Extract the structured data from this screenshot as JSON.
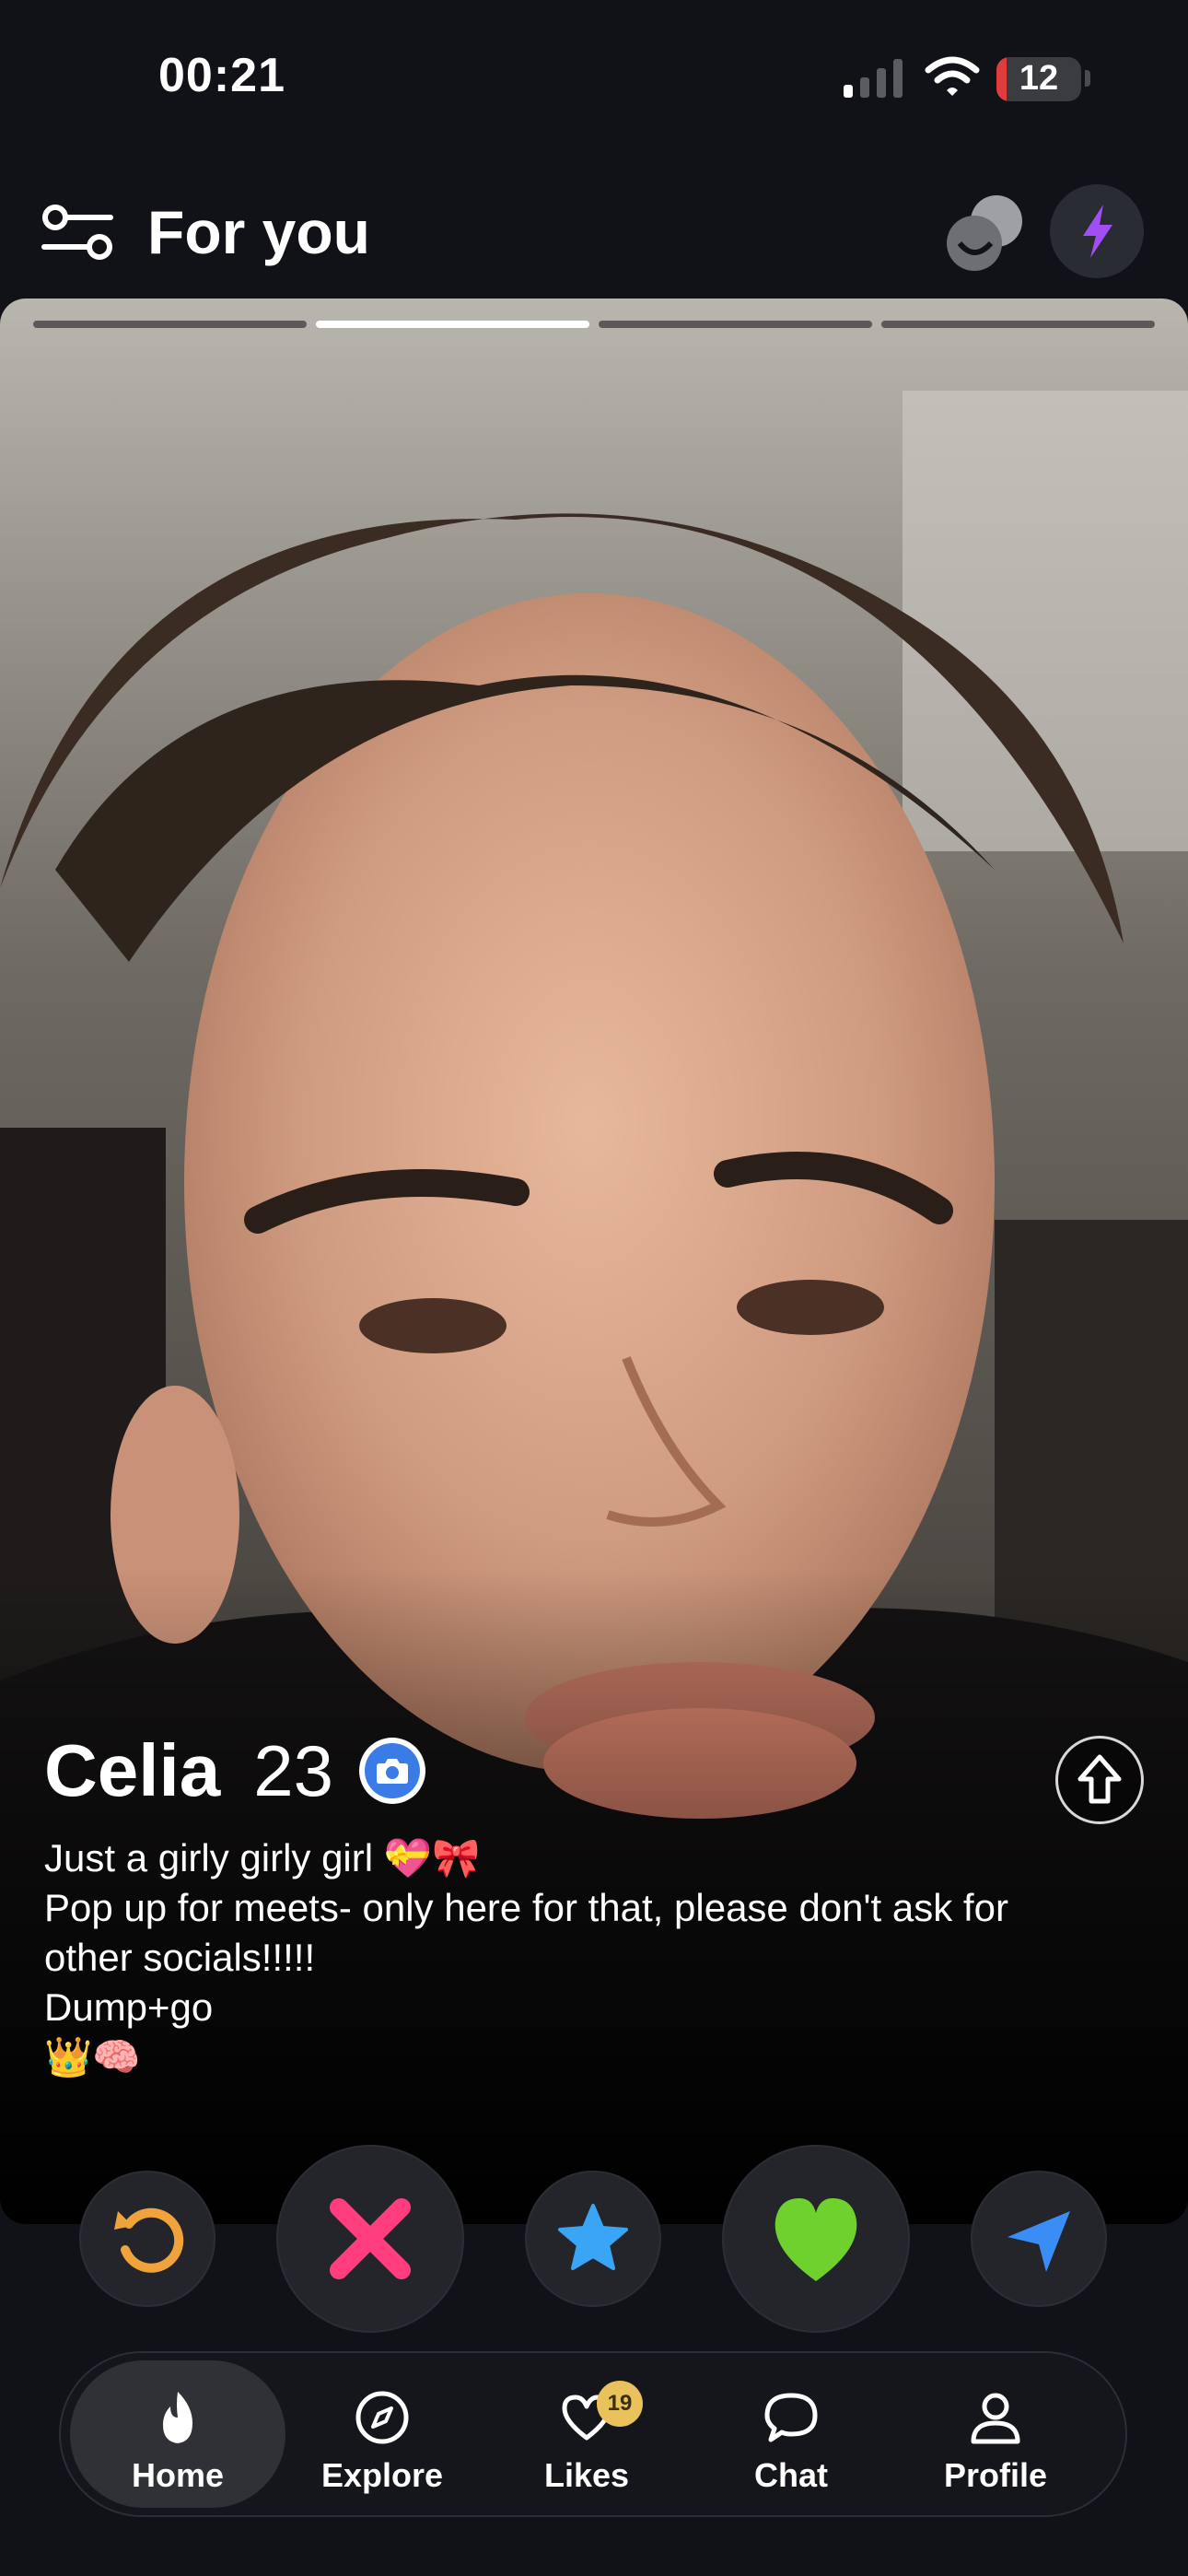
{
  "status_bar": {
    "time": "00:21",
    "battery_level": "12",
    "battery_percent": 0.12
  },
  "header": {
    "title": "For you"
  },
  "profile": {
    "photo_count": 4,
    "active_photo": 2,
    "name": "Celia",
    "age": "23",
    "bio": [
      "Just a girly girly girl 💝🎀",
      "Pop up for meets- only here for that, please don't ask for",
      "other socials!!!!!",
      "Dump+go",
      "👑🧠"
    ]
  },
  "actions": [
    "rewind-icon",
    "nope-icon",
    "super-like-icon",
    "like-icon",
    "send-icon"
  ],
  "colors": {
    "background": "#111217",
    "rewind": "#f0a33a",
    "nope": "#ff3d7f",
    "super_like": "#3aa5f5",
    "like": "#6fd12d",
    "boost": "#a24ef5",
    "verify": "#3a7be8"
  },
  "nav": {
    "items": [
      {
        "label": "Home",
        "icon": "flame-icon",
        "active": true
      },
      {
        "label": "Explore",
        "icon": "compass-icon"
      },
      {
        "label": "Likes",
        "icon": "heart-icon",
        "badge": "19"
      },
      {
        "label": "Chat",
        "icon": "chat-bubble-icon"
      },
      {
        "label": "Profile",
        "icon": "person-icon"
      }
    ]
  }
}
